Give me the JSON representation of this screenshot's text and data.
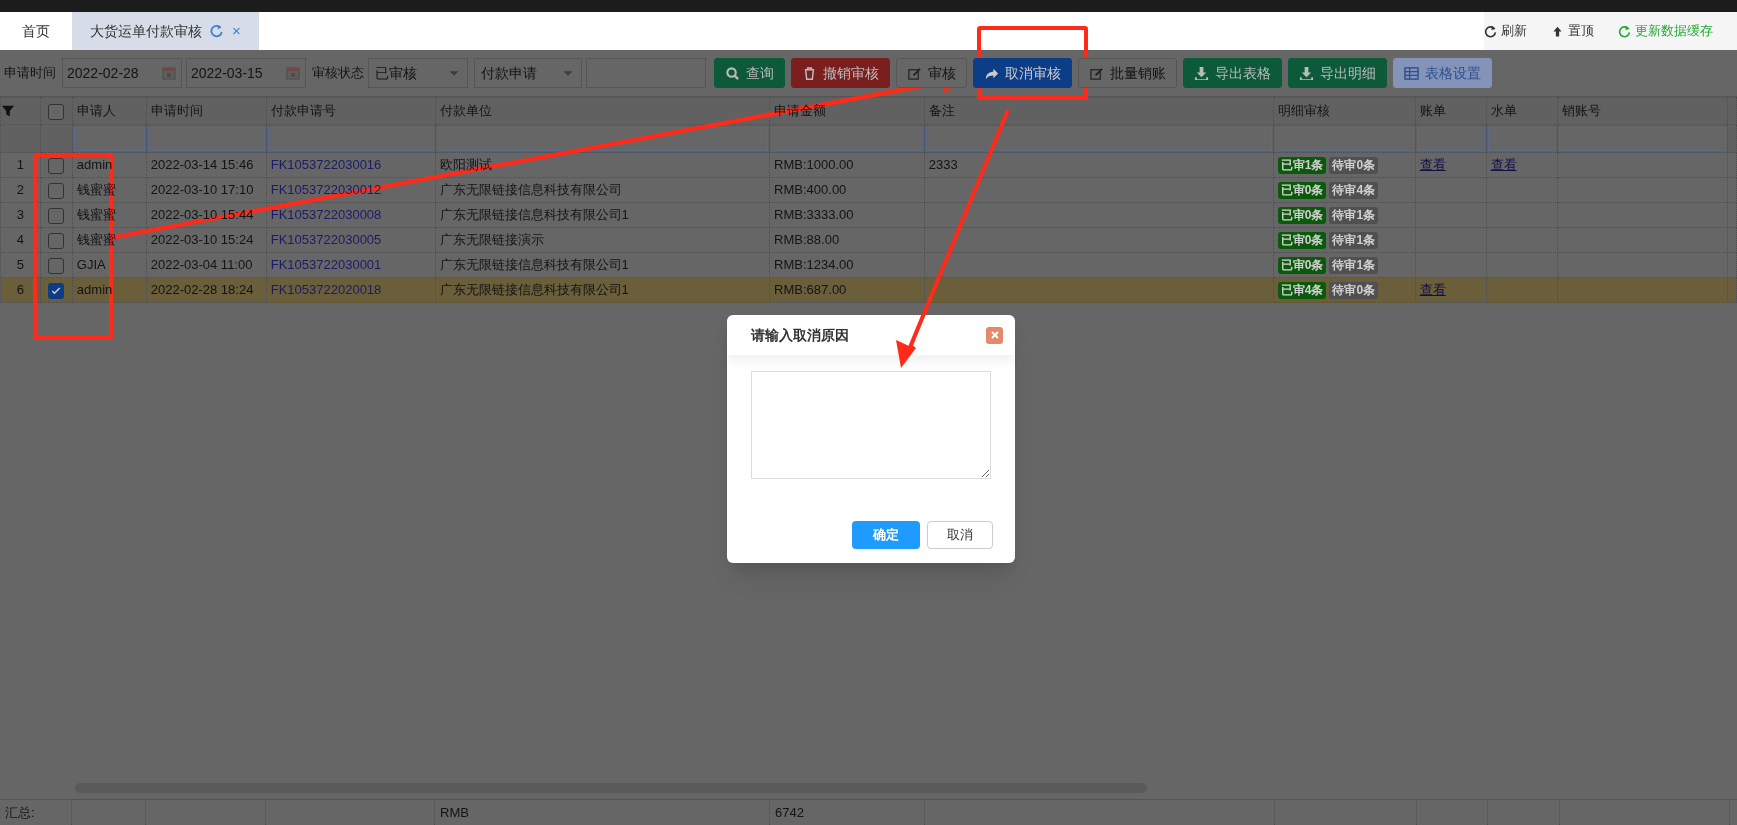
{
  "tabs": [
    {
      "label": "首页",
      "selected": false
    },
    {
      "label": "大货运单付款审核",
      "selected": true,
      "close": "×"
    }
  ],
  "top_actions": [
    {
      "label": "刷新",
      "color": "#333333"
    },
    {
      "label": "置顶",
      "color": "#333333"
    },
    {
      "label": "更新数据缓存",
      "color": "#22aa33"
    }
  ],
  "filters": {
    "date_label": "申请时间",
    "date_from": "2022-02-28",
    "date_to": "2022-03-15",
    "status_label": "审核状态",
    "status_value": "已审核",
    "field_select": "付款申请"
  },
  "buttons": [
    {
      "label": "查询"
    },
    {
      "label": "撤销审核"
    },
    {
      "label": "审核"
    },
    {
      "label": "取消审核"
    },
    {
      "label": "批量销账"
    },
    {
      "label": "导出表格"
    },
    {
      "label": "导出明细"
    },
    {
      "label": "表格设置"
    }
  ],
  "table": {
    "header_checked": false,
    "columns": [
      "申请人",
      "申请时间",
      "付款申请号",
      "付款单位",
      "申请金额",
      "备注",
      "明细审核",
      "账单",
      "水单",
      "销账号"
    ],
    "rows": [
      {
        "index": "1",
        "checked": false,
        "selected": false,
        "applicant": "admin",
        "time": "2022-03-14 15:46",
        "number": "FK1053722030016",
        "unit": "欧阳测试",
        "amount": "RMB:1000.00",
        "note": "2333",
        "badges": [
          {
            "text": "已审1条",
            "color": "#0b5a0b"
          },
          {
            "text": "待审0条",
            "color": "#505050"
          }
        ],
        "bill": "查看",
        "slip": "查看"
      },
      {
        "index": "2",
        "checked": false,
        "selected": false,
        "applicant": "钱蜜蜜",
        "time": "2022-03-10 17:10",
        "number": "FK1053722030012",
        "unit": "广东无限链接信息科技有限公司",
        "amount": "RMB:400.00",
        "badges": [
          {
            "text": "已审0条",
            "color": "#0b5a0b"
          },
          {
            "text": "待审4条",
            "color": "#505050"
          }
        ]
      },
      {
        "index": "3",
        "checked": false,
        "selected": false,
        "applicant": "钱蜜蜜",
        "time": "2022-03-10 15:44",
        "number": "FK1053722030008",
        "unit": "广东无限链接信息科技有限公司1",
        "amount": "RMB:3333.00",
        "badges": [
          {
            "text": "已审0条",
            "color": "#0b5a0b"
          },
          {
            "text": "待审1条",
            "color": "#505050"
          }
        ]
      },
      {
        "index": "4",
        "checked": false,
        "selected": false,
        "applicant": "钱蜜蜜",
        "time": "2022-03-10 15:24",
        "number": "FK1053722030005",
        "unit": "广东无限链接演示",
        "amount": "RMB:88.00",
        "badges": [
          {
            "text": "已审0条",
            "color": "#0b5a0b"
          },
          {
            "text": "待审1条",
            "color": "#505050"
          }
        ]
      },
      {
        "index": "5",
        "checked": false,
        "selected": false,
        "applicant": "GJIA",
        "time": "2022-03-04 11:00",
        "number": "FK1053722030001",
        "unit": "广东无限链接信息科技有限公司1",
        "amount": "RMB:1234.00",
        "badges": [
          {
            "text": "已审0条",
            "color": "#0b5a0b"
          },
          {
            "text": "待审1条",
            "color": "#505050"
          }
        ]
      },
      {
        "index": "6",
        "checked": true,
        "selected": true,
        "applicant": "admin",
        "time": "2022-02-28 18:24",
        "number": "FK1053722020018",
        "unit": "广东无限链接信息科技有限公司1",
        "amount": "RMB:687.00",
        "badges": [
          {
            "text": "已审4条",
            "color": "#0b5a0b"
          },
          {
            "text": "待审0条",
            "color": "#505050"
          }
        ],
        "bill": "查看"
      }
    ],
    "summary": {
      "label": "汇总:",
      "currency": "RMB",
      "total": "6742"
    }
  },
  "dialog": {
    "title": "请输入取消原因",
    "confirm": "确定",
    "cancel": "取消"
  }
}
